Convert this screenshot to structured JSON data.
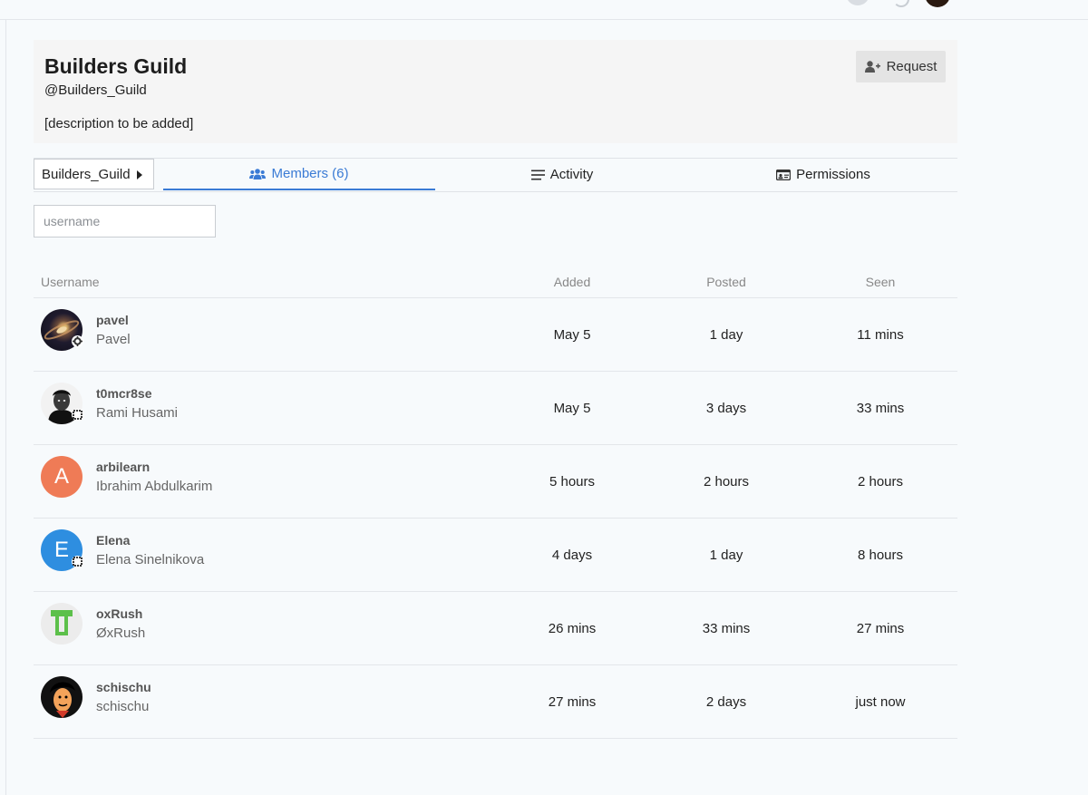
{
  "team": {
    "title": "Builders Guild",
    "handle": "@Builders_Guild",
    "description": "[description to be added]",
    "request_label": "Request"
  },
  "tabs": {
    "team_select": "Builders_Guild",
    "members": "Members (6)",
    "activity": "Activity",
    "permissions": "Permissions"
  },
  "search": {
    "placeholder": "username"
  },
  "table": {
    "columns": [
      "Username",
      "Added",
      "Posted",
      "Seen"
    ],
    "rows": [
      {
        "username": "pavel",
        "name": "Pavel",
        "added": "May 5",
        "posted": "1 day",
        "seen": "11 mins",
        "avatar": "galaxy-image",
        "badge": "gear-icon"
      },
      {
        "username": "t0mcr8se",
        "name": "Rami Husami",
        "added": "May 5",
        "posted": "3 days",
        "seen": "33 mins",
        "avatar": "portrait-image",
        "badge": "shield-icon"
      },
      {
        "username": "arbilearn",
        "name": "Ibrahim Abdulkarim",
        "added": "5 hours",
        "posted": "2 hours",
        "seen": "2 hours",
        "avatar_letter": "A",
        "avatar_color": "#ef7b56"
      },
      {
        "username": "Elena",
        "name": "Elena Sinelnikova",
        "added": "4 days",
        "posted": "1 day",
        "seen": "8 hours",
        "avatar_letter": "E",
        "avatar_color": "#2e8ee0",
        "badge": "shield-icon"
      },
      {
        "username": "oxRush",
        "name": "ØxRush",
        "added": "26 mins",
        "posted": "33 mins",
        "seen": "27 mins",
        "avatar": "green-logo"
      },
      {
        "username": "schischu",
        "name": "schischu",
        "added": "27 mins",
        "posted": "2 days",
        "seen": "just now",
        "avatar": "cartoon-image"
      }
    ]
  },
  "colors": {
    "accent": "#3a7bd5",
    "card_bg": "#f5f5f5",
    "page_bg": "#f7fafc"
  }
}
